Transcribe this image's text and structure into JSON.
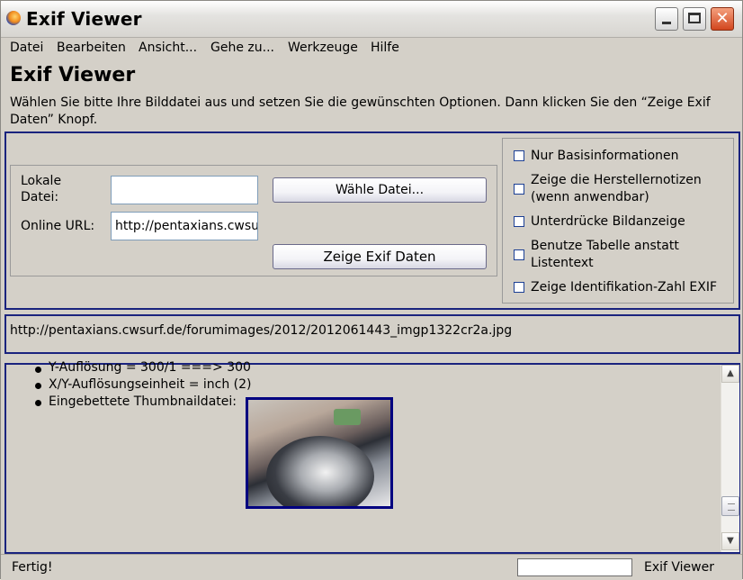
{
  "window": {
    "title": "Exif Viewer"
  },
  "menu": {
    "items": [
      "Datei",
      "Bearbeiten",
      "Ansicht...",
      "Gehe zu...",
      "Werkzeuge",
      "Hilfe"
    ]
  },
  "main": {
    "heading": "Exif Viewer",
    "intro": "Wählen Sie bitte Ihre Bilddatei aus und setzen Sie die gewünschten Optionen. Dann klicken Sie den “Zeige Exif Daten” Knopf."
  },
  "form": {
    "local_label": "Lokale Datei:",
    "local_value": "",
    "url_label": "Online URL:",
    "url_value": "http://pentaxians.cwsurf.de/forumimages/2012/2012061443_imgp1322cr2a.jpg",
    "choose_button": "Wähle Datei...",
    "show_button": "Zeige Exif Daten"
  },
  "options": [
    {
      "label": "Nur Basisinformationen",
      "checked": false
    },
    {
      "label": "Zeige die Herstellernotizen (wenn anwendbar)",
      "checked": false
    },
    {
      "label": "Unterdrücke Bildanzeige",
      "checked": false
    },
    {
      "label": "Benutze Tabelle anstatt Listentext",
      "checked": false
    },
    {
      "label": "Zeige Identifikation-Zahl EXIF",
      "checked": false
    }
  ],
  "current_url": "http://pentaxians.cwsurf.de/forumimages/2012/2012061443_imgp1322cr2a.jpg",
  "output": {
    "items": [
      "Y-Auflösung = 300/1 ===> 300",
      "X/Y-Auflösungseinheit = inch (2)",
      "Eingebettete Thumbnaildatei:"
    ]
  },
  "status": {
    "text": "Fertig!",
    "app": "Exif Viewer"
  }
}
